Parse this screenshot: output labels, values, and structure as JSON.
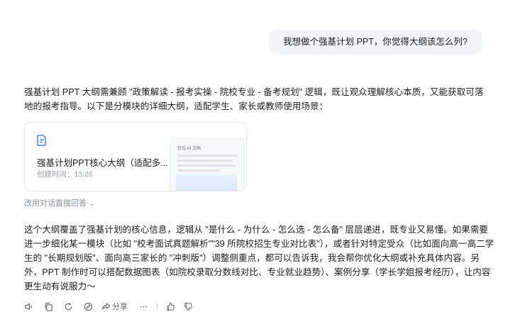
{
  "user_message": "我想做个强基计划 PPT，你觉得大纲该怎么列?",
  "assistant": {
    "intro": "强基计划 PPT 大纲需兼顾 \"政策解读 - 报考实操 - 院校专业 - 备考规划\" 逻辑，既让观众理解核心本质，又能获取可落地的报考指导。以下是分模块的详细大纲，适配学生、家长或教师使用场景：",
    "doc_card": {
      "title": "强基计划PPT核心大纲（适配多...",
      "created": "创建时间：13:26",
      "preview_header": "豆包 AI 文档"
    },
    "reply_link": "改用对话直接回答",
    "closing": "这个大纲覆盖了强基计划的核心信息，逻辑从 \"是什么 - 为什么 - 怎么选 - 怎么备\" 层层递进，既专业又易懂。如果需要进一步细化某一模块（比如 \"校考面试真题解析\"\"39 所院校招生专业对比表\"），或者针对特定受众（比如面向高一高二学生的 \"长期规划版\"、面向高三家长的 \"冲刺版\"）调整侧重点，都可以告诉我，我会帮你优化大纲或补充具体内容。另外，PPT 制作时可以搭配数据图表（如院校录取分数线对比、专业就业趋势）、案例分享（学长学姐报考经历），让内容更生动有说服力～"
  },
  "toolbar": {
    "share_label": "分享",
    "icons": [
      "speaker-icon",
      "copy-icon",
      "regenerate-icon",
      "edit-icon",
      "share-icon",
      "more-icon",
      "thumbs-up-icon",
      "thumbs-down-icon"
    ]
  },
  "colors": {
    "user_bubble_bg": "#f2f3f5",
    "accent": "#4e7ef7",
    "muted_text": "#8a8f98"
  }
}
